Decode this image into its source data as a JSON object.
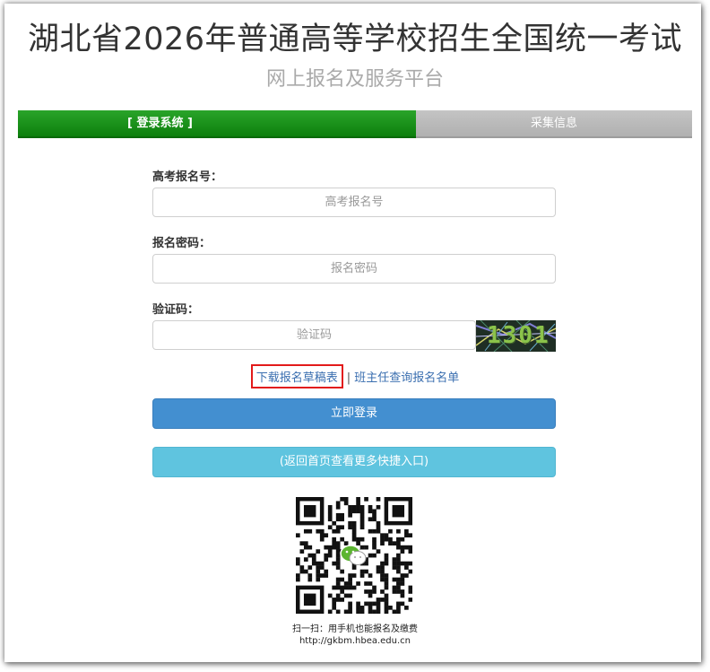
{
  "header": {
    "title": "湖北省2026年普通高等学校招生全国统一考试",
    "subtitle": "网上报名及服务平台"
  },
  "steps": [
    {
      "label": "[ 登录系统 ]",
      "active": true
    },
    {
      "label": "采集信息",
      "active": false
    }
  ],
  "form": {
    "exam_no": {
      "label": "高考报名号：",
      "placeholder": "高考报名号",
      "value": ""
    },
    "password": {
      "label": "报名密码：",
      "placeholder": "报名密码",
      "value": ""
    },
    "captcha": {
      "label": "验证码：",
      "placeholder": "验证码",
      "value": "",
      "image_text": "1301"
    }
  },
  "links": {
    "download_draft": "下载报名草稿表",
    "separator": "|",
    "teacher_query": "班主任查询报名名单"
  },
  "buttons": {
    "login": "立即登录",
    "home": "(返回首页查看更多快捷入口)"
  },
  "qr": {
    "caption": "扫一扫：用手机也能报名及缴费",
    "url": "http://gkbm.hbea.edu.cn"
  },
  "colors": {
    "active_step": "#0d7f0d",
    "inactive_step": "#b8b8b8",
    "login_button": "#438fd0",
    "home_button": "#5fc4df",
    "highlight_border": "#e21a1a",
    "link": "#3b6fb0"
  }
}
